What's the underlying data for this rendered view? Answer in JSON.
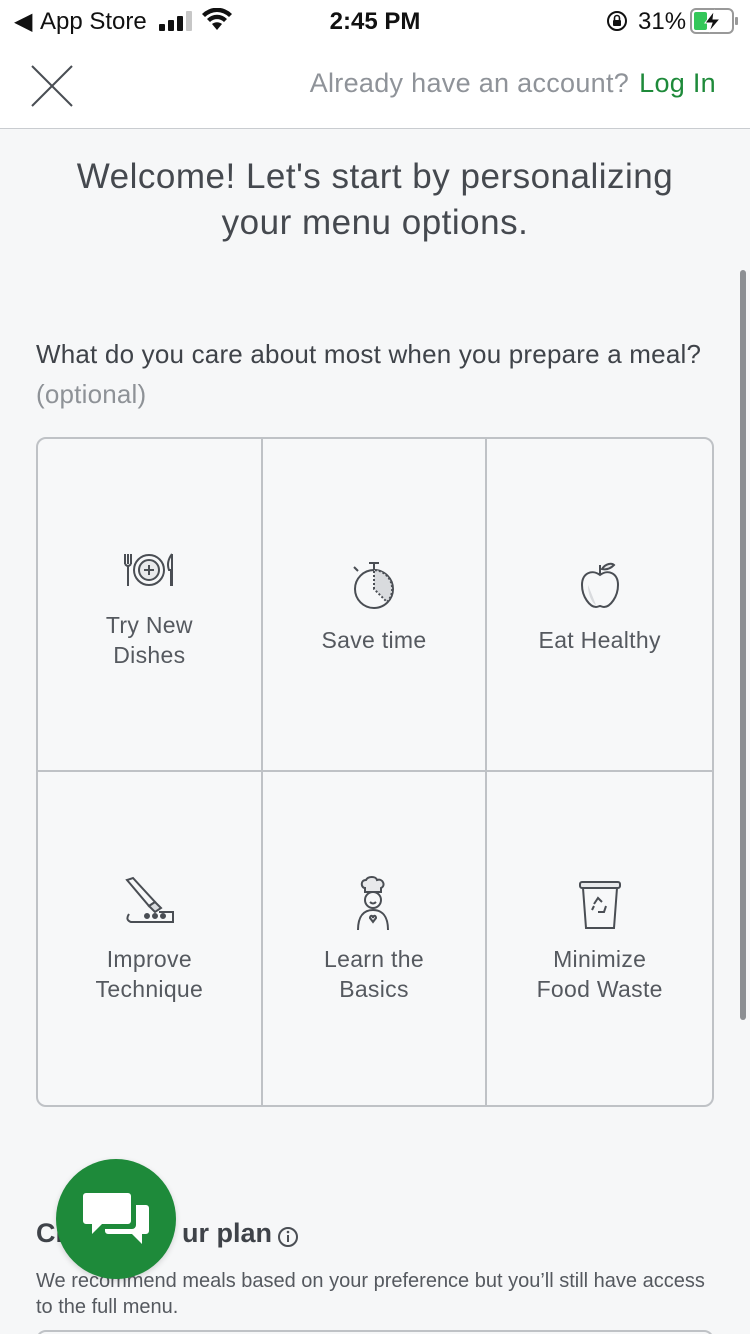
{
  "status_bar": {
    "back_label": "◀",
    "carrier": "App Store",
    "time": "2:45 PM",
    "battery": "31%"
  },
  "header": {
    "account_prompt": "Already have an account?",
    "login_label": "Log In"
  },
  "welcome": {
    "line1": "Welcome! Let's start by personalizing",
    "line2": "your menu options."
  },
  "question": {
    "text": "What do you care about most when you prepare a meal?",
    "optional": "(optional)"
  },
  "options": [
    {
      "label": "Try New Dishes",
      "icon": "plate-cutlery-icon"
    },
    {
      "label": "Save time",
      "icon": "stopwatch-icon"
    },
    {
      "label": "Eat Healthy",
      "icon": "apple-icon"
    },
    {
      "label": "Improve Technique",
      "icon": "knife-board-icon"
    },
    {
      "label": "Learn the Basics",
      "icon": "chef-icon"
    },
    {
      "label": "Minimize Food Waste",
      "icon": "recycle-bin-icon"
    }
  ],
  "plan": {
    "title_visible_left": "Cl",
    "title_visible_right": "ur plan",
    "description": "We recommend meals based on your preference but you’ll still have access to the full menu."
  },
  "colors": {
    "accent_green": "#1e8a3a",
    "border": "#bfc2c6",
    "background": "#f6f7f8"
  }
}
